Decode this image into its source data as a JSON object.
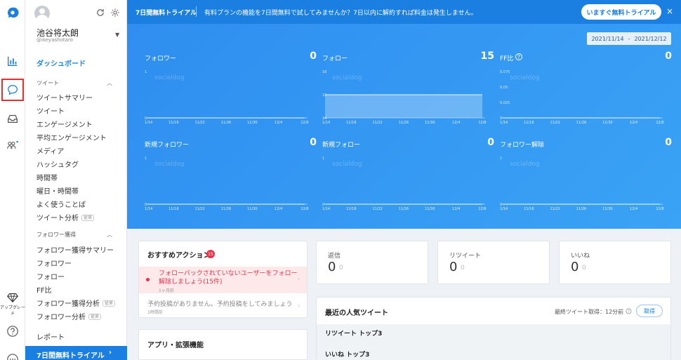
{
  "rail": {
    "upgrade_label": "アップグレード"
  },
  "sidebar": {
    "user_name": "池谷将太朗",
    "user_handle": "@ikeyashotaro",
    "dashboard": "ダッシュボード",
    "tweet_section": "ツイート",
    "tweet_items": [
      {
        "label": "ツイートサマリー"
      },
      {
        "label": "ツイート"
      },
      {
        "label": "エンゲージメント"
      },
      {
        "label": "平均エンゲージメント"
      },
      {
        "label": "メディア"
      },
      {
        "label": "ハッシュタグ"
      },
      {
        "label": "時間帯"
      },
      {
        "label": "曜日・時間帯"
      },
      {
        "label": "よく使うことば"
      },
      {
        "label": "ツイート分析",
        "badge": "従来"
      }
    ],
    "follower_section": "フォロワー獲得",
    "follower_items": [
      {
        "label": "フォロワー獲得サマリー"
      },
      {
        "label": "フォロワー"
      },
      {
        "label": "フォロー"
      },
      {
        "label": "FF比"
      },
      {
        "label": "フォロワー獲得分析",
        "badge": "従来"
      },
      {
        "label": "フォロワー分析",
        "badge": "従来"
      }
    ],
    "report": "レポート",
    "trial": "7日間無料トライアル"
  },
  "banner": {
    "title": "7日間無料トライアル",
    "message": "有料プランの機能を7日間無料で試してみませんか？7日以内に解約すれば料金は発生しません。",
    "cta": "いますぐ無料トライアル",
    "close": "×"
  },
  "hero": {
    "date_from": "2021/11/14",
    "date_sep": "-",
    "date_to": "2021/12/12",
    "watermark": "socialdog"
  },
  "chart_data": [
    {
      "type": "line",
      "title": "フォロワー",
      "total": "0",
      "x": [
        "11/14",
        "11/18",
        "11/22",
        "11/26",
        "11/30",
        "12/4",
        "12/8"
      ],
      "yticks": [
        "1",
        "0"
      ],
      "ylim": [
        0,
        1
      ],
      "values": [
        0,
        0,
        0,
        0,
        0,
        0,
        0
      ]
    },
    {
      "type": "area",
      "title": "フォロー",
      "total": "15",
      "x": [
        "11/14",
        "11/18",
        "11/22",
        "11/26",
        "11/30",
        "12/4",
        "12/8"
      ],
      "yticks": [
        "16",
        "15",
        "14"
      ],
      "ylim": [
        14,
        16
      ],
      "values": [
        15,
        15,
        15,
        15,
        15,
        15,
        15
      ]
    },
    {
      "type": "line",
      "title": "FF比",
      "total": "0",
      "x": [
        "11/14",
        "11/18",
        "11/22",
        "11/26",
        "11/30",
        "12/4",
        "12/8"
      ],
      "yticks": [
        "0.075",
        "0.05",
        "0.025",
        "0"
      ],
      "ylim": [
        0,
        0.075
      ],
      "values": [
        0,
        0,
        0,
        0,
        0,
        0,
        0
      ]
    },
    {
      "type": "line",
      "title": "新規フォロワー",
      "total": "0",
      "x": [
        "11/14",
        "11/18",
        "11/22",
        "11/26",
        "11/30",
        "12/4",
        "12/8"
      ],
      "yticks": [
        "1",
        "0"
      ],
      "ylim": [
        0,
        1
      ],
      "values": [
        0,
        0,
        0,
        0,
        0,
        0,
        0
      ]
    },
    {
      "type": "line",
      "title": "新規フォロー",
      "total": "0",
      "x": [
        "11/14",
        "11/18",
        "11/22",
        "11/26",
        "11/30",
        "12/4",
        "12/8"
      ],
      "yticks": [
        "1",
        "0"
      ],
      "ylim": [
        0,
        1
      ],
      "values": [
        0,
        0,
        0,
        0,
        0,
        0,
        0
      ]
    },
    {
      "type": "line",
      "title": "フォロワー解除",
      "total": "0",
      "x": [
        "11/14",
        "11/18",
        "11/22",
        "11/26",
        "11/30",
        "12/4",
        "12/8"
      ],
      "yticks": [
        "1",
        "0"
      ],
      "ylim": [
        0,
        1
      ],
      "values": [
        0,
        0,
        0,
        0,
        0,
        0,
        0
      ]
    }
  ],
  "recommend": {
    "title": "おすすめアクション",
    "badge": "15",
    "item1": "フォローバックされていないユーザーをフォロー解除しましょう(15件)",
    "item1_time": "1ヶ月前",
    "item2": "予約投稿がありません。予約投稿をしてみましょう",
    "item2_time": "1時間前"
  },
  "apps": {
    "title": "アプリ・拡張機能"
  },
  "stats": [
    {
      "label": "返信",
      "value": "0",
      "sub": "0"
    },
    {
      "label": "リツイート",
      "value": "0",
      "sub": "0"
    },
    {
      "label": "いいね",
      "value": "0",
      "sub": "0"
    }
  ],
  "popular": {
    "title": "最近の人気ツイート",
    "last_fetch": "最終ツイート取得：12分前",
    "fetch_button": "取得",
    "retweet_top": "リツイート トップ3",
    "like_top": "いいね トップ3"
  }
}
